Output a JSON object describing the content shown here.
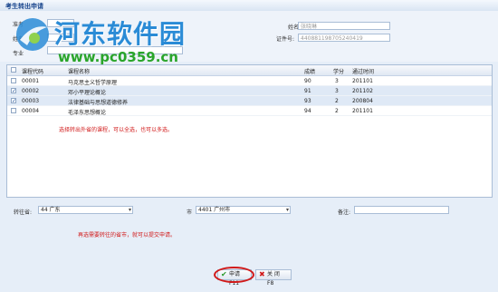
{
  "window": {
    "title": "考生转出申请"
  },
  "top_form": {
    "left_labels": [
      "准考",
      "姓名",
      "专业"
    ],
    "name_label": "姓名:",
    "name_value": "张晓琳",
    "id_label": "证件号:",
    "id_value": "440881198705240419"
  },
  "watermark": {
    "text": "河东软件园",
    "url": "www.pc0359.cn"
  },
  "grid": {
    "headers": [
      "课程代码",
      "课程名称",
      "成绩",
      "学分",
      "通过时间"
    ],
    "rows": [
      {
        "code": "00001",
        "name": "马克思主义哲学原理",
        "score": "90",
        "credit": "3",
        "date": "201101",
        "checked": false
      },
      {
        "code": "00002",
        "name": "邓小平理论概论",
        "score": "91",
        "credit": "3",
        "date": "201102",
        "checked": true
      },
      {
        "code": "00003",
        "name": "法律基础与思想道德修养",
        "score": "93",
        "credit": "2",
        "date": "200804",
        "checked": true
      },
      {
        "code": "00004",
        "name": "毛泽东思想概论",
        "score": "94",
        "credit": "2",
        "date": "201101",
        "checked": false
      }
    ],
    "hint": "选择转出外省的课程，可以全选，也可以多选。"
  },
  "bottom_form": {
    "province_label": "转往省:",
    "province_value": "44 广东",
    "city_label": "市",
    "city_value": "4401 广州市",
    "note_label": "备注:",
    "note_value": "",
    "hint": "再选需要转往的省市，就可以提交申请。"
  },
  "buttons": {
    "submit": "申请 F11",
    "close": "关 闭 F8"
  },
  "icons": {
    "submit": "check-icon",
    "close": "x-icon",
    "logo": "logo-icon"
  },
  "colors": {
    "accent": "#15428b",
    "hint": "#d11a1a",
    "watermark": "#2a8bd6"
  }
}
